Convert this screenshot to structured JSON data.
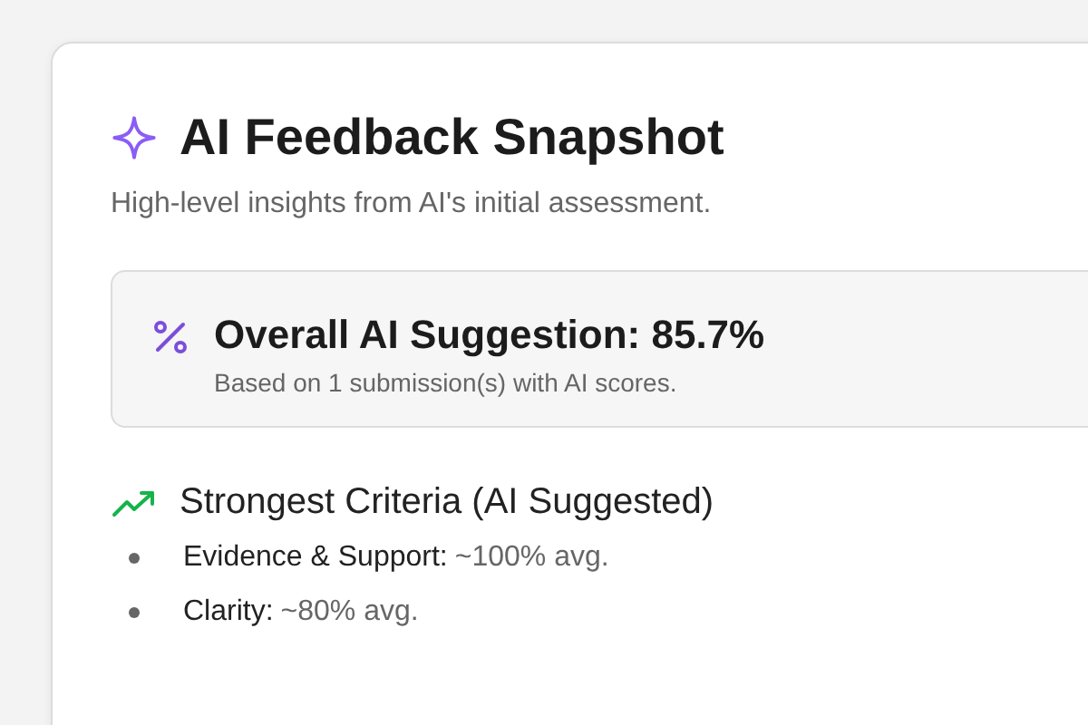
{
  "card": {
    "title": "AI Feedback Snapshot",
    "subtitle": "High-level insights from AI's initial assessment."
  },
  "overall": {
    "heading": "Overall AI Suggestion: 85.7%",
    "note": "Based on 1 submission(s) with AI scores."
  },
  "strongest": {
    "heading": "Strongest Criteria (AI Suggested)",
    "items": [
      {
        "name": "Evidence & Support:",
        "value": "~100% avg."
      },
      {
        "name": "Clarity:",
        "value": "~80% avg."
      }
    ]
  }
}
